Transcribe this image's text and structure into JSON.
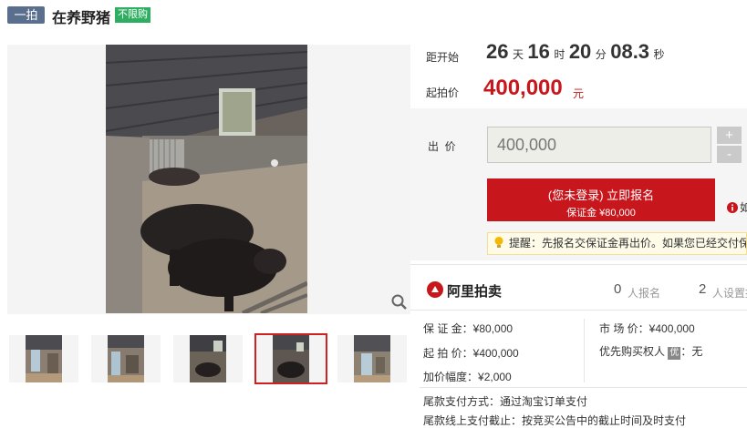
{
  "header": {
    "tag": "一拍",
    "title": "在养野猪",
    "badge": "不限购"
  },
  "countdown": {
    "label": "距开始",
    "days": "26",
    "days_unit": "天",
    "hours": "16",
    "hours_unit": "时",
    "minutes": "20",
    "minutes_unit": "分",
    "seconds": "08.3",
    "seconds_unit": "秒"
  },
  "start_price": {
    "label": "起拍价",
    "value": "400,000",
    "unit": "元"
  },
  "bid": {
    "label": "出  价",
    "value": "400,000",
    "plus": "+",
    "minus": "-",
    "signup_line1": "(您未登录) 立即报名",
    "signup_line2": "保证金 ¥80,000",
    "reminder": "提醒：先报名交保证金再出价。如果您已经交付保",
    "side_glyph": "如"
  },
  "platform": {
    "name": "阿里拍卖",
    "signup_count": "0",
    "signup_label": "人报名",
    "reminder_count": "2",
    "reminder_label": "人设置提醒"
  },
  "details": {
    "deposit_label": "保 证 金：",
    "deposit": "¥80,000",
    "market_label": "市 场 价：",
    "market": "¥400,000",
    "start_label": "起 拍 价：",
    "start": "¥400,000",
    "priority_label": "优先购买权人",
    "priority_badge": "优",
    "priority_value": "：无",
    "increment_label": "加价幅度：",
    "increment": "¥2,000",
    "final_payment_label": "尾款支付方式：",
    "final_payment": "通过淘宝订单支付",
    "deadline_label": "尾款线上支付截止：",
    "deadline": "按竞买公告中的截止时间及时支付"
  }
}
